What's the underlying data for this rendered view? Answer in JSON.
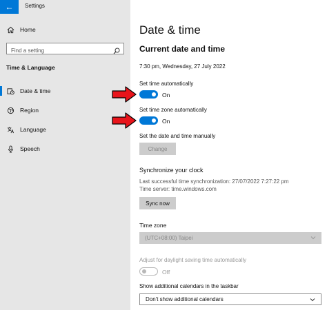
{
  "window": {
    "title": "Settings",
    "back_glyph": "←"
  },
  "sidebar": {
    "home_label": "Home",
    "search_placeholder": "Find a setting",
    "section": "Time & Language",
    "items": [
      {
        "label": "Date & time",
        "icon": "calendar-clock-icon",
        "active": true
      },
      {
        "label": "Region",
        "icon": "globe-icon"
      },
      {
        "label": "Language",
        "icon": "language-icon"
      },
      {
        "label": "Speech",
        "icon": "microphone-icon"
      }
    ]
  },
  "main": {
    "title": "Date & time",
    "subtitle": "Current date and time",
    "current_datetime": "7:30 pm, Wednesday, 27 July 2022",
    "set_time_auto": {
      "label": "Set time automatically",
      "state": "On"
    },
    "set_zone_auto": {
      "label": "Set time zone automatically",
      "state": "On"
    },
    "manual": {
      "label": "Set the date and time manually",
      "button": "Change"
    },
    "sync": {
      "heading": "Synchronize your clock",
      "last_sync": "Last successful time synchronization: 27/07/2022 7:27:22 pm",
      "server": "Time server: time.windows.com",
      "button": "Sync now"
    },
    "timezone": {
      "label": "Time zone",
      "value": "(UTC+08:00) Taipei"
    },
    "daylight": {
      "label": "Adjust for daylight saving time automatically",
      "state": "Off"
    },
    "calendars": {
      "label": "Show additional calendars in the taskbar",
      "value": "Don't show additional calendars"
    }
  },
  "colors": {
    "accent": "#0078d7",
    "sidebar_bg": "#e6e6e6",
    "annotation_arrow": "#e8141b"
  }
}
